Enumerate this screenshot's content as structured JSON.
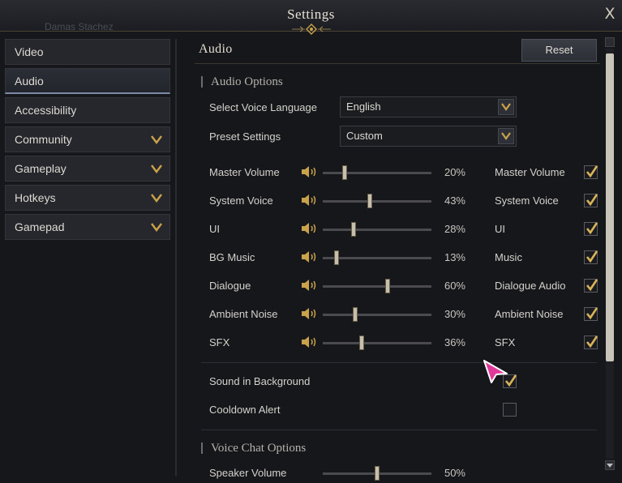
{
  "window": {
    "title": "Settings",
    "close_glyph": "X",
    "background_ghost_text": "Damas Stachez"
  },
  "sidebar": {
    "items": [
      {
        "label": "Video",
        "chevron": false,
        "active": false
      },
      {
        "label": "Audio",
        "chevron": false,
        "active": true
      },
      {
        "label": "Accessibility",
        "chevron": false,
        "active": false
      },
      {
        "label": "Community",
        "chevron": true,
        "active": false
      },
      {
        "label": "Gameplay",
        "chevron": true,
        "active": false
      },
      {
        "label": "Hotkeys",
        "chevron": true,
        "active": false
      },
      {
        "label": "Gamepad",
        "chevron": true,
        "active": false
      }
    ]
  },
  "main": {
    "section_title": "Audio",
    "reset_label": "Reset",
    "audio_options_title": "Audio Options",
    "voice_language": {
      "label": "Select Voice Language",
      "value": "English"
    },
    "preset": {
      "label": "Preset Settings",
      "value": "Custom"
    },
    "volumes": [
      {
        "label": "Master Volume",
        "value": 20,
        "pct": "20%",
        "toggle_label": "Master Volume",
        "checked": true
      },
      {
        "label": "System Voice",
        "value": 43,
        "pct": "43%",
        "toggle_label": "System Voice",
        "checked": true
      },
      {
        "label": "UI",
        "value": 28,
        "pct": "28%",
        "toggle_label": "UI",
        "checked": true
      },
      {
        "label": "BG Music",
        "value": 13,
        "pct": "13%",
        "toggle_label": "Music",
        "checked": true
      },
      {
        "label": "Dialogue",
        "value": 60,
        "pct": "60%",
        "toggle_label": "Dialogue Audio",
        "checked": true
      },
      {
        "label": "Ambient Noise",
        "value": 30,
        "pct": "30%",
        "toggle_label": "Ambient Noise",
        "checked": true
      },
      {
        "label": "SFX",
        "value": 36,
        "pct": "36%",
        "toggle_label": "SFX",
        "checked": true
      }
    ],
    "sound_in_background": {
      "label": "Sound in Background",
      "checked": true
    },
    "cooldown_alert": {
      "label": "Cooldown Alert",
      "checked": false
    },
    "voice_chat_title": "Voice Chat Options",
    "speaker_volume": {
      "label": "Speaker Volume",
      "value": 50,
      "pct": "50%"
    }
  },
  "colors": {
    "accent_gold": "#c9a24a",
    "check_gold": "#d8b45a",
    "cursor_pink": "#e0399a"
  },
  "icons": {
    "chevron": "chevron-down-icon",
    "speaker": "speaker-icon",
    "check": "check-icon"
  }
}
